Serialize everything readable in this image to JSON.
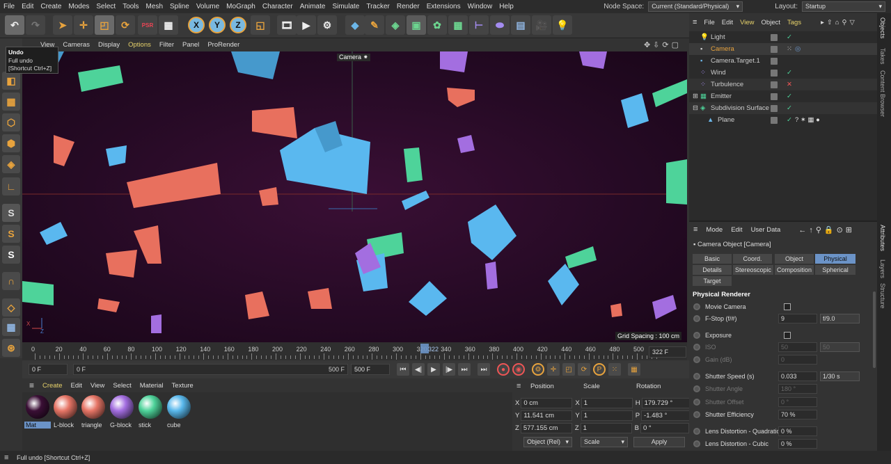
{
  "menubar": {
    "items": [
      "File",
      "Edit",
      "Create",
      "Modes",
      "Select",
      "Tools",
      "Mesh",
      "Spline",
      "Volume",
      "MoGraph",
      "Character",
      "Animate",
      "Simulate",
      "Tracker",
      "Render",
      "Extensions",
      "Window",
      "Help"
    ],
    "node_space_label": "Node Space:",
    "node_space_value": "Current (Standard/Physical)",
    "layout_label": "Layout:",
    "layout_value": "Startup"
  },
  "tooltip": {
    "title": "Undo",
    "line1": "Full undo",
    "line2": "[Shortcut Ctrl+Z]"
  },
  "viewport_menu": [
    "View",
    "Cameras",
    "Display",
    "Options",
    "Filter",
    "Panel",
    "ProRender"
  ],
  "viewport": {
    "camera_label": "Camera",
    "grid_spacing": "Grid Spacing : 100 cm"
  },
  "timeline": {
    "ticks": [
      "0",
      "20",
      "40",
      "60",
      "80",
      "100",
      "120",
      "140",
      "160",
      "180",
      "200",
      "220",
      "240",
      "260",
      "280",
      "300",
      "320",
      "340",
      "360",
      "380",
      "400",
      "420",
      "440",
      "460",
      "480",
      "500"
    ],
    "current_marker": "322",
    "current_frame": "322 F",
    "start": "0 F",
    "range_start": "0 F",
    "range_end": "500 F",
    "end": "500 F"
  },
  "material_manager": {
    "menu": [
      "Create",
      "Edit",
      "View",
      "Select",
      "Material",
      "Texture"
    ],
    "materials": [
      {
        "name": "Mat",
        "color": "#3a0f35"
      },
      {
        "name": "L-block",
        "color": "#e67566"
      },
      {
        "name": "triangle",
        "color": "#e67566"
      },
      {
        "name": "G-block",
        "color": "#a36ee0"
      },
      {
        "name": "stick",
        "color": "#4ed39a"
      },
      {
        "name": "cube",
        "color": "#59b8ec"
      }
    ]
  },
  "coordinates": {
    "headers": [
      "Position",
      "Scale",
      "Rotation"
    ],
    "rows": [
      {
        "axis": "X",
        "pos": "0 cm",
        "s_axis": "X",
        "scale": "1",
        "r_axis": "H",
        "rot": "179.729 °"
      },
      {
        "axis": "Y",
        "pos": "11.541 cm",
        "s_axis": "Y",
        "scale": "1",
        "r_axis": "P",
        "rot": "-1.483 °"
      },
      {
        "axis": "Z",
        "pos": "577.155 cm",
        "s_axis": "Z",
        "scale": "1",
        "r_axis": "B",
        "rot": "0 °"
      }
    ],
    "mode": "Object (Rel)",
    "scale_mode": "Scale",
    "apply": "Apply"
  },
  "status": "Full undo [Shortcut Ctrl+Z]",
  "object_manager": {
    "menu": [
      "File",
      "Edit",
      "View",
      "Object",
      "Tags"
    ],
    "objects": [
      {
        "name": "Light",
        "indent": 0,
        "check": "green"
      },
      {
        "name": "Camera",
        "indent": 0,
        "check": "green",
        "selected": true
      },
      {
        "name": "Camera.Target.1",
        "indent": 0,
        "check": "green"
      },
      {
        "name": "Wind",
        "indent": 0,
        "check": "green"
      },
      {
        "name": "Turbulence",
        "indent": 0,
        "check": "red"
      },
      {
        "name": "Emitter",
        "indent": 0,
        "check": "green"
      },
      {
        "name": "Subdivision Surface",
        "indent": 0,
        "check": "green"
      },
      {
        "name": "Plane",
        "indent": 1,
        "check": "green"
      }
    ]
  },
  "right_tabs": [
    "Objects",
    "Takes",
    "Content Browser",
    "Attributes",
    "Layers",
    "Structure"
  ],
  "attributes": {
    "menu": [
      "Mode",
      "Edit",
      "User Data"
    ],
    "title": "Camera Object [Camera]",
    "tabs_row1": [
      "Basic",
      "Coord.",
      "Object",
      "Physical"
    ],
    "tabs_row2": [
      "Details",
      "Stereoscopic",
      "Composition",
      "Spherical"
    ],
    "tabs_row3": [
      "Target"
    ],
    "active_tab": "Physical",
    "section": "Physical Renderer",
    "fields": {
      "movie_camera": "Movie Camera",
      "fstop_label": "F-Stop (f/#)",
      "fstop_value": "9",
      "fstop_preset": "f/9.0",
      "exposure": "Exposure",
      "iso_label": "ISO",
      "iso_value": "50",
      "iso_preset": "50",
      "gain_label": "Gain (dB)",
      "gain_value": "0",
      "shutter_label": "Shutter Speed (s)",
      "shutter_value": "0.033",
      "shutter_preset": "1/30 s",
      "shutter_angle_label": "Shutter Angle",
      "shutter_angle_value": "180 °",
      "shutter_offset_label": "Shutter Offset",
      "shutter_offset_value": "0 °",
      "efficiency_label": "Shutter Efficiency",
      "efficiency_value": "70 %",
      "lens_quad_label": "Lens Distortion - Quadratic",
      "lens_quad_value": "0 %",
      "lens_cubic_label": "Lens Distortion - Cubic",
      "lens_cubic_value": "0 %"
    }
  }
}
